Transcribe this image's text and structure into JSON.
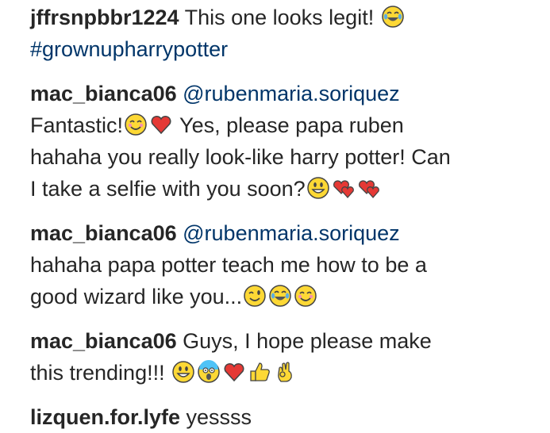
{
  "comments": [
    {
      "username": "jffrsnpbbr1224",
      "text_before": " This one looks legit! ",
      "emojis_after_text": [
        "laughing-tears"
      ],
      "hashtag": "#grownupharrypotter"
    },
    {
      "username": "mac_bianca06",
      "mention": "@rubenmaria.soriquez",
      "line1": "Fantastic!",
      "line1_emojis": [
        "smiling-blush",
        "heart"
      ],
      "line1_tail": " Yes, please papa ruben",
      "line2": "hahaha you really look-like harry potter! Can",
      "line3": "I take a selfie with you soon?",
      "line3_emojis": [
        "grinning",
        "two-hearts",
        "two-hearts"
      ]
    },
    {
      "username": "mac_bianca06",
      "mention": "@rubenmaria.soriquez",
      "line1": "hahaha papa potter teach me how to be a",
      "line2": "good wizard like you...",
      "line2_emojis": [
        "winking",
        "laughing-tears",
        "smiling-blush"
      ]
    },
    {
      "username": "mac_bianca06",
      "text_before": " Guys, I hope please make",
      "line2": "this trending!!! ",
      "line2_emojis": [
        "grinning",
        "screaming",
        "heart",
        "thumbs-up",
        "ok-hand"
      ]
    },
    {
      "username": "lizquen.for.lyfe",
      "text_before": " yessss"
    }
  ],
  "colors": {
    "text": "#262626",
    "link": "#003569",
    "background": "#ffffff"
  }
}
